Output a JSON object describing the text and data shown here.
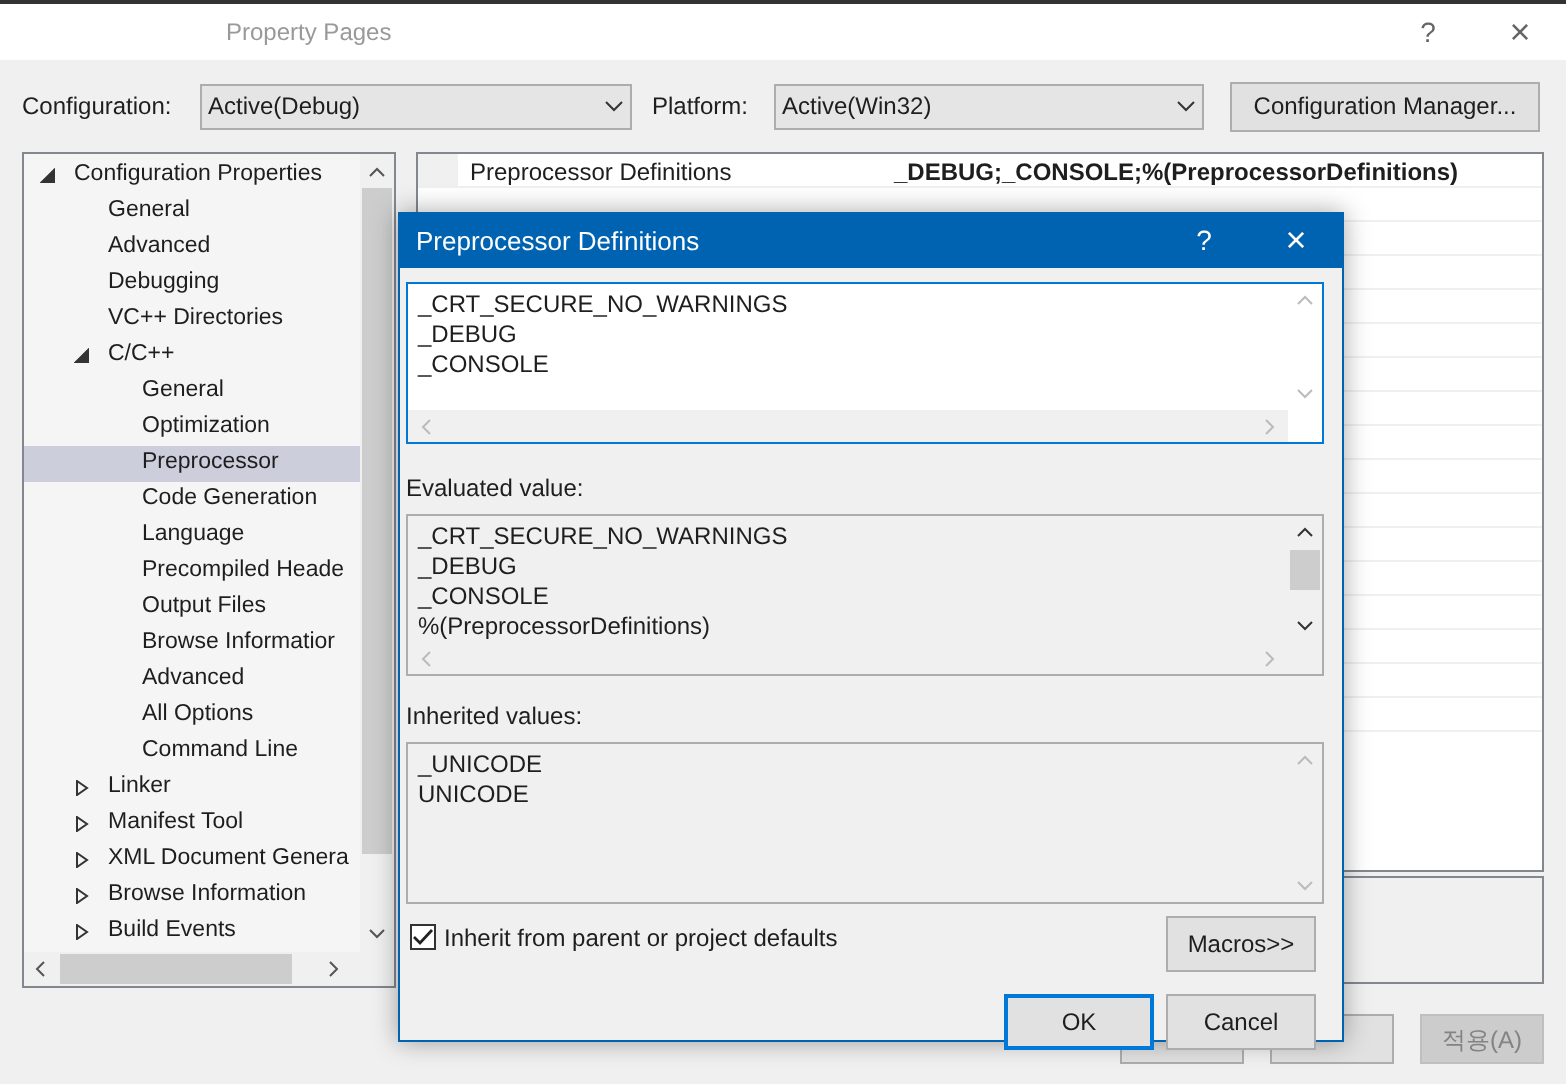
{
  "window": {
    "title": "Property Pages",
    "help": "?",
    "close": "×"
  },
  "toolbar": {
    "configuration_label": "Configuration:",
    "configuration": "Active(Debug)",
    "platform_label": "Platform:",
    "platform": "Active(Win32)",
    "manager_button": "Configuration Manager..."
  },
  "tree": [
    {
      "label": "Configuration Properties",
      "expanded": true,
      "selected": false,
      "children": [
        {
          "label": "General",
          "selected": false
        },
        {
          "label": "Advanced",
          "selected": false
        },
        {
          "label": "Debugging",
          "selected": false
        },
        {
          "label": "VC++ Directories",
          "selected": false
        },
        {
          "label": "C/C++",
          "expanded": true,
          "selected": false,
          "children": [
            {
              "label": "General",
              "selected": false
            },
            {
              "label": "Optimization",
              "selected": false
            },
            {
              "label": "Preprocessor",
              "selected": true
            },
            {
              "label": "Code Generation",
              "selected": false
            },
            {
              "label": "Language",
              "selected": false
            },
            {
              "label": "Precompiled Heade",
              "selected": false
            },
            {
              "label": "Output Files",
              "selected": false
            },
            {
              "label": "Browse Informatior",
              "selected": false
            },
            {
              "label": "Advanced",
              "selected": false
            },
            {
              "label": "All Options",
              "selected": false
            },
            {
              "label": "Command Line",
              "selected": false
            }
          ]
        },
        {
          "label": "Linker",
          "expanded": false,
          "selected": false
        },
        {
          "label": "Manifest Tool",
          "expanded": false,
          "selected": false
        },
        {
          "label": "XML Document Genera",
          "expanded": false,
          "selected": false
        },
        {
          "label": "Browse Information",
          "expanded": false,
          "selected": false
        },
        {
          "label": "Build Events",
          "expanded": false,
          "selected": false
        }
      ]
    }
  ],
  "properties": [
    {
      "name": "Preprocessor Definitions",
      "value": "_DEBUG;_CONSOLE;%(PreprocessorDefinitions)"
    }
  ],
  "footer_buttons": [
    {
      "disabled": false
    },
    {
      "disabled": false
    },
    {
      "label": "적용(A)",
      "disabled": true
    }
  ],
  "dialog": {
    "title": "Preprocessor Definitions",
    "help": "?",
    "close": "×",
    "definitions": [
      "_CRT_SECURE_NO_WARNINGS",
      "_DEBUG",
      "_CONSOLE"
    ],
    "evaluated_label": "Evaluated value:",
    "evaluated": [
      "_CRT_SECURE_NO_WARNINGS",
      "_DEBUG",
      "_CONSOLE",
      "%(PreprocessorDefinitions)"
    ],
    "inherited_label": "Inherited values:",
    "inherited": [
      "_UNICODE",
      "UNICODE"
    ],
    "inherit_checkbox": {
      "label": "Inherit from parent or project defaults",
      "checked": true
    },
    "macros_button": "Macros>>",
    "ok_button": "OK",
    "cancel_button": "Cancel"
  }
}
